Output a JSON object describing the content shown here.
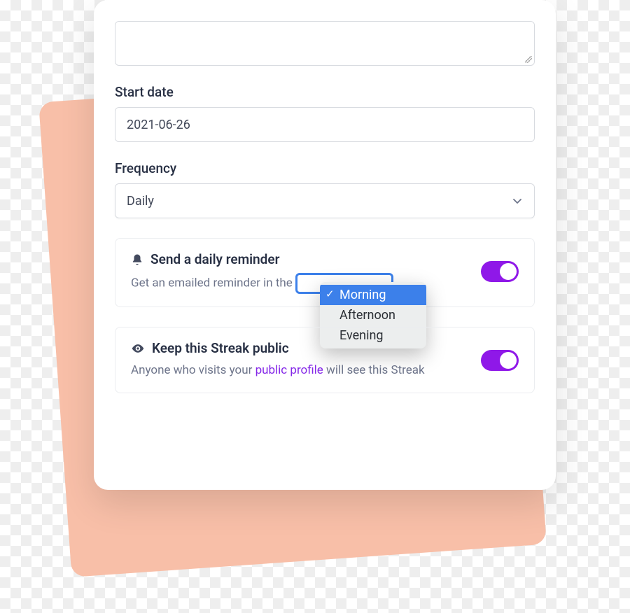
{
  "form": {
    "startDate": {
      "label": "Start date",
      "value": "2021-06-26"
    },
    "frequency": {
      "label": "Frequency",
      "value": "Daily"
    }
  },
  "reminder": {
    "title": "Send a daily reminder",
    "descPrefix": "Get an emailed reminder in the ",
    "options": [
      "Morning",
      "Afternoon",
      "Evening"
    ],
    "selected": "Morning"
  },
  "publicStreak": {
    "title": "Keep this Streak public",
    "descPrefix": "Anyone who visits your ",
    "link": "public profile",
    "descSuffix": " will see this Streak"
  }
}
